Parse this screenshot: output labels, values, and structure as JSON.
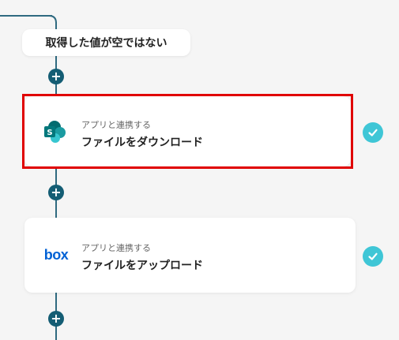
{
  "condition": {
    "label": "取得した値が空ではない"
  },
  "steps": [
    {
      "subtitle": "アプリと連携する",
      "title": "ファイルをダウンロード",
      "app_icon": "sharepoint-icon",
      "status_icon": "check-icon"
    },
    {
      "subtitle": "アプリと連携する",
      "title": "ファイルをアップロード",
      "app_icon": "box-logo",
      "app_logo_text": "box",
      "status_icon": "check-icon"
    }
  ],
  "add_icon": "plus-icon",
  "colors": {
    "connector": "#2f6a80",
    "add_button": "#145d74",
    "check": "#3fc6d6",
    "highlight": "#e00000",
    "box_blue": "#0061d5"
  }
}
